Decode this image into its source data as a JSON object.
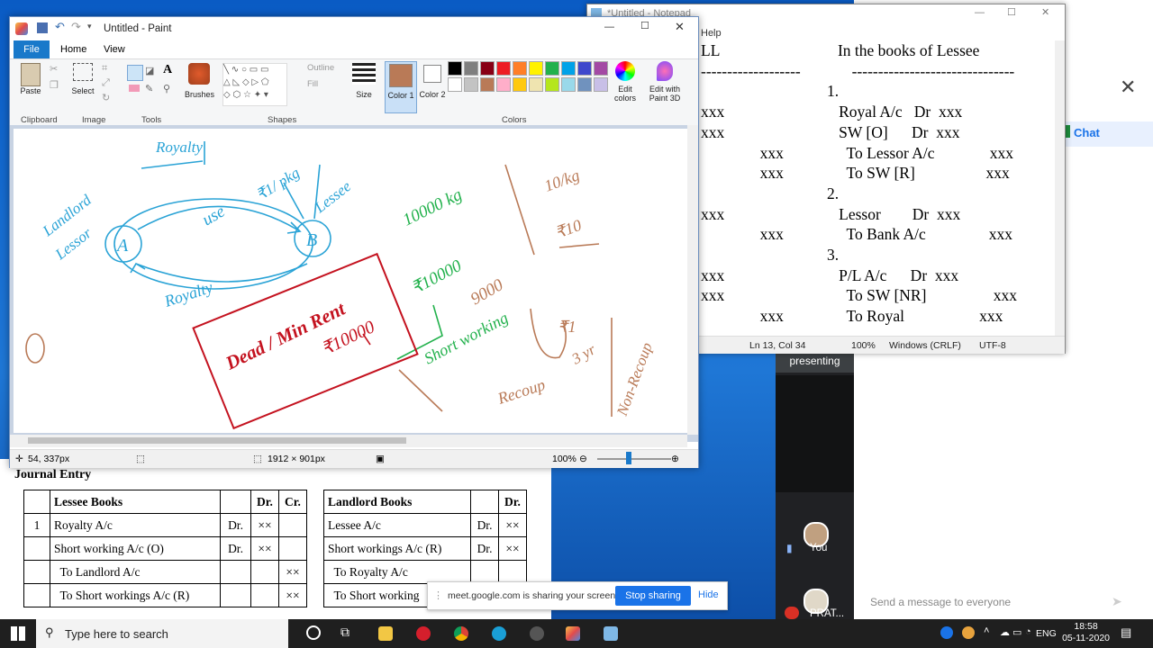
{
  "paint": {
    "title": "Untitled - Paint",
    "tabs": [
      "File",
      "Home",
      "View"
    ],
    "ribbon": {
      "paste": "Paste",
      "select": "Select",
      "brushes": "Brushes",
      "outline": "Outline",
      "fill": "Fill",
      "size": "Size",
      "color1": "Color 1",
      "color2": "Color 2",
      "edit_colors": "Edit colors",
      "edit_paint3d": "Edit with Paint 3D",
      "groups": [
        "Clipboard",
        "Image",
        "Tools",
        "Shapes",
        "Colors"
      ],
      "palette": [
        "#000000",
        "#7f7f7f",
        "#880015",
        "#ed1c24",
        "#ff7f27",
        "#fff200",
        "#22b14c",
        "#00a2e8",
        "#3f48cc",
        "#a349a4",
        "#ffffff",
        "#c3c3c3",
        "#b97a57",
        "#ffaec9",
        "#ffc90e",
        "#efe4b0",
        "#b5e61d",
        "#99d9ea",
        "#7092be",
        "#c8bfe7"
      ]
    },
    "canvas_text": {
      "royalty_top": "Royalty",
      "landlord": "Landlord",
      "lessor": "Lessor",
      "use": "use",
      "a": "A",
      "b": "B",
      "rate": "₹1/ pkg",
      "lessee": "Lessee",
      "royalty_arc": "Royalty",
      "qty": "10000 kg",
      "amt": "₹10000",
      "amt2": "9000",
      "rate2": "10/kg",
      "amt3": "₹10",
      "dead_rent": "Dead / Min Rent",
      "dead_amt": "₹10000",
      "short_working": "Short working",
      "recoup": "Recoup",
      "rs1": "₹1",
      "rs3": "3 yr",
      "non": "Non-Recoup"
    },
    "status": {
      "pos": "54, 337px",
      "size": "1912 × 901px",
      "zoom": "100%"
    }
  },
  "notepad": {
    "title": "*Untitled - Notepad",
    "menu": "Help",
    "lines": [
      "LL                              In the books of Lessee",
      "-------------------             -------------------------------",
      "                                1.",
      "xxx                             Royal A/c   Dr  xxx",
      "xxx                             SW [O]      Dr  xxx",
      "               xxx                To Lessor A/c              xxx",
      "               xxx                To SW [R]                  xxx",
      "                                2.",
      "xxx                             Lessor        Dr  xxx",
      "               xxx                To Bank A/c                xxx",
      "                                3.",
      "xxx                             P/L A/c      Dr  xxx",
      "xxx                               To SW [NR]                 xxx",
      "               xxx                To Royal                   xxx"
    ],
    "status": {
      "pos": "Ln 13, Col 34",
      "zoom": "100%",
      "eol": "Windows (CRLF)",
      "enc": "UTF-8"
    }
  },
  "journal": {
    "title": "Journal Entry",
    "lessee_head": "Lessee Books",
    "dr": "Dr.",
    "cr": "Cr.",
    "lessee_rows": [
      {
        "no": "1",
        "text": "Royalty A/c",
        "dr": "Dr.",
        "v1": "××",
        "v2": ""
      },
      {
        "no": "",
        "text": "Short working A/c (O)",
        "dr": "Dr.",
        "v1": "××",
        "v2": ""
      },
      {
        "no": "",
        "text": "  To Landlord A/c",
        "dr": "",
        "v1": "",
        "v2": "××"
      },
      {
        "no": "",
        "text": "  To Short workings A/c (R)",
        "dr": "",
        "v1": "",
        "v2": "××"
      }
    ],
    "landlord_head": "Landlord Books",
    "landlord_rows": [
      {
        "text": "Lessee A/c",
        "dr": "Dr.",
        "v1": "××"
      },
      {
        "text": "Short workings A/c (R)",
        "dr": "Dr.",
        "v1": "××"
      },
      {
        "text": "  To Royalty A/c",
        "dr": "",
        "v1": ""
      },
      {
        "text": "  To Short working",
        "dr": "",
        "v1": ""
      }
    ]
  },
  "meet": {
    "chat_tab": "Chat",
    "presenting": "presenting",
    "you": "You",
    "other": "PRAT...",
    "message_placeholder": "Send a message to everyone"
  },
  "share": {
    "message": "meet.google.com is sharing your screen.",
    "stop": "Stop sharing",
    "hide": "Hide"
  },
  "taskbar": {
    "search": "Type here to search",
    "lang": "ENG",
    "time": "18:58",
    "date": "05-11-2020"
  }
}
